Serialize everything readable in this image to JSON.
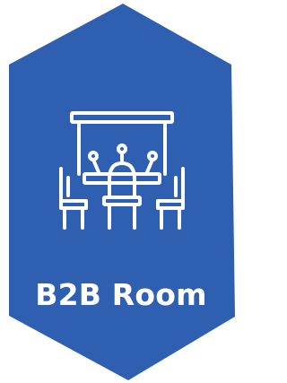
{
  "tile": {
    "label": "B2B Room",
    "icon": "conference-room-icon",
    "background_color": "#2f5fb1",
    "foreground_color": "#ffffff"
  }
}
